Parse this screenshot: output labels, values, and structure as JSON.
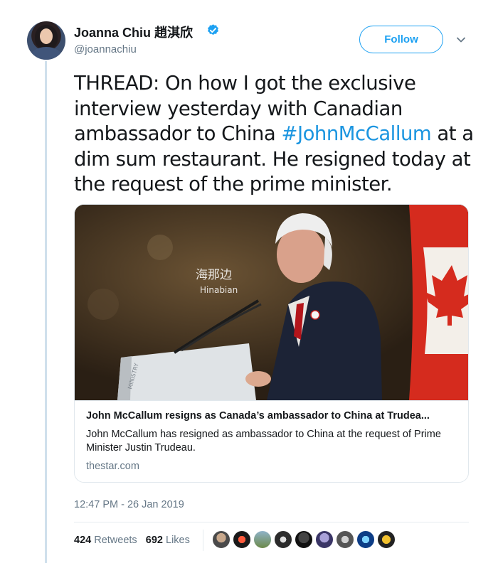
{
  "author": {
    "name": "Joanna Chiu 趙淇欣",
    "handle": "@joannachiu",
    "verified": true
  },
  "follow_label": "Follow",
  "tweet": {
    "text_before": "THREAD: On how I got the exclusive interview yesterday with Canadian ambassador to China ",
    "hashtag": "#JohnMcCallum",
    "text_after": " at a dim sum restaurant. He resigned today at the request of the prime minister."
  },
  "card": {
    "watermark_cn": "海那边",
    "watermark_en": "Hinabian",
    "title": "John McCallum resigns as Canada’s ambassador to China at Trudea...",
    "description": "John McCallum has resigned as ambassador to China at the request of Prime Minister Justin Trudeau.",
    "domain": "thestar.com"
  },
  "timestamp": "12:47 PM - 26 Jan 2019",
  "stats": {
    "retweets_count": "424",
    "retweets_label": "Retweets",
    "likes_count": "692",
    "likes_label": "Likes"
  },
  "colors": {
    "accent": "#1da1f2",
    "hashtag": "#1b95e0",
    "secondary_text": "#657786"
  },
  "icons": [
    "verified-badge-icon",
    "chevron-down-icon"
  ]
}
